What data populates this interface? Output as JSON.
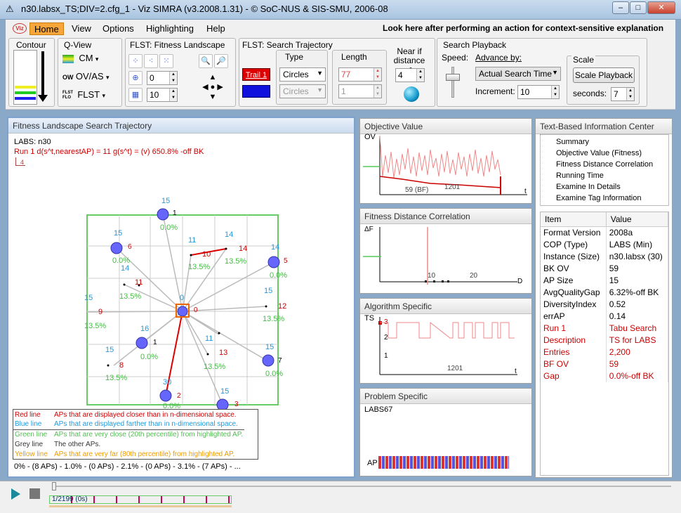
{
  "window": {
    "title": "n30.labsx_TS;DIV=2.cfg_1 - Viz SIMRA (v3.2008.1.31) - © SoC-NUS & SIS-SMU, 2006-08",
    "min": "–",
    "max": "□",
    "close": "✕"
  },
  "menu": {
    "logo": "Viz",
    "items": [
      "Home",
      "View",
      "Options",
      "Highlighting",
      "Help"
    ],
    "hint": "Look here after performing an action for context-sensitive explanation"
  },
  "ribbon": {
    "contour": {
      "label": "Contour"
    },
    "qview": {
      "label": "Q-View",
      "items": [
        "CM",
        "OV/AS",
        "FLST"
      ],
      "prefix": [
        "",
        "OW",
        "FLST FLO"
      ]
    },
    "flst": {
      "label": "FLST: Fitness Landscape",
      "spin1": "0",
      "spin2": "10"
    },
    "search": {
      "label": "FLST: Search Trajectory",
      "trail_btn": "Trail 1",
      "type_label": "Type",
      "type1": "Circles",
      "type2": "Circles",
      "length_label": "Length",
      "length1": "77",
      "length2": "1",
      "near_label": "Near if distance ≤",
      "near_val": "4"
    },
    "playback": {
      "label": "Search Playback",
      "speed": "Speed:",
      "advance": "Advance by:",
      "advance_val": "Actual Search Time",
      "increment": "Increment:",
      "increment_val": "10",
      "scale": "Scale",
      "scale_btn": "Scale Playback",
      "seconds": "seconds:",
      "seconds_val": "7"
    }
  },
  "fl": {
    "title": "Fitness Landscape Search Trajectory",
    "labs": "LABS: n30",
    "run": "Run 1   d(s^t,nearestAP) = 11   g(s^t) = (v) 650.8% -off BK",
    "scale": "4",
    "nodes": [
      {
        "n": "1",
        "d": "15",
        "p": "0.0%"
      },
      {
        "n": "6",
        "d": "15",
        "p": "0.0%"
      },
      {
        "n": "5",
        "d": "14",
        "p": "0.0%"
      },
      {
        "n": "1",
        "d": "16",
        "p": "0.0%"
      },
      {
        "n": "7",
        "d": "15",
        "p": "0.0%"
      },
      {
        "n": "2",
        "d": "30",
        "p": "0.0%"
      },
      {
        "n": "3",
        "d": "15",
        "p": "0.0%"
      },
      {
        "n": "0",
        "d": "0",
        "p": ""
      }
    ],
    "labels": {
      "l10": "10",
      "l14a": "14",
      "l14b": "14",
      "l11a": "11",
      "l11b": "11",
      "l13": "13",
      "l12": "12",
      "l9": "9",
      "l8": "8",
      "l14c": "14",
      "l15a": "15",
      "l15b": "15",
      "l15c": "15",
      "l15d": "15",
      "l11c": "11",
      "p1": "13.5%",
      "p2": "13.5%",
      "p3": "13.5%",
      "p4": "13.5%",
      "p5": "13.5%",
      "p6": "13.5%"
    },
    "legend": [
      {
        "k": "Red line",
        "v": "APs that are displayed closer than in n-dimensional space.",
        "c": "#c00"
      },
      {
        "k": "Blue line",
        "v": "APs that are displayed farther than in n-dimensional space.",
        "c": "#29d"
      },
      {
        "k": "Green line",
        "v": "APs that are very close (20th percentile) from highlighted AP.",
        "c": "#5b5"
      },
      {
        "k": "Grey line",
        "v": "The other APs.",
        "c": "#333"
      },
      {
        "k": "Yellow line",
        "v": "APs that are very far (80th percentile) from highlighted AP.",
        "c": "#e90"
      }
    ],
    "footer": "0% - (8 APs) - 1.0% - (0 APs) - 2.1% - (0 APs) - 3.1% - (7 APs) - ..."
  },
  "ov": {
    "title": "Objective Value",
    "ylabel": "OV",
    "x1": "59 (BF)",
    "x2": "1201",
    "t": "t"
  },
  "fdc": {
    "title": "Fitness Distance Correlation",
    "ylabel": "ΔF",
    "x1": "10",
    "x2": "20",
    "d": "D"
  },
  "alg": {
    "title": "Algorithm Specific",
    "ylabel": "TS",
    "y1": "3",
    "y2": "2",
    "y3": "1",
    "x1": "1201",
    "t": "t"
  },
  "prob": {
    "title": "Problem Specific",
    "name": "LABS67",
    "ap": "AP"
  },
  "tbic": {
    "title": "Text-Based Information Center",
    "tree": [
      "Summary",
      "Objective Value (Fitness)",
      "Fitness Distance Correlation",
      "Running Time",
      "Examine In Details",
      "Examine Tag Information"
    ],
    "h1": "Item",
    "h2": "Value",
    "rows": [
      {
        "k": "Format Version",
        "v": "2008a",
        "r": false
      },
      {
        "k": "COP (Type)",
        "v": "LABS (Min)",
        "r": false
      },
      {
        "k": "Instance (Size)",
        "v": "n30.labsx (30)",
        "r": false
      },
      {
        "k": " BK OV",
        "v": "59",
        "r": false
      },
      {
        "k": "AP Size",
        "v": "15",
        "r": false
      },
      {
        "k": "  AvgQualityGap",
        "v": "6.32%-off BK",
        "r": false
      },
      {
        "k": "  DiversityIndex",
        "v": "0.52",
        "r": false
      },
      {
        "k": "  errAP",
        "v": "0.14",
        "r": false
      },
      {
        "k": "Run 1",
        "v": "Tabu Search",
        "r": true
      },
      {
        "k": "  Description",
        "v": "TS for LABS",
        "r": true
      },
      {
        "k": "  Entries",
        "v": "2,200",
        "r": true
      },
      {
        "k": "  BF OV",
        "v": "59",
        "r": true
      },
      {
        "k": "  Gap",
        "v": "0.0%-off BK",
        "r": true
      }
    ]
  },
  "bottom": {
    "pos": "1/2199 (0s)"
  }
}
